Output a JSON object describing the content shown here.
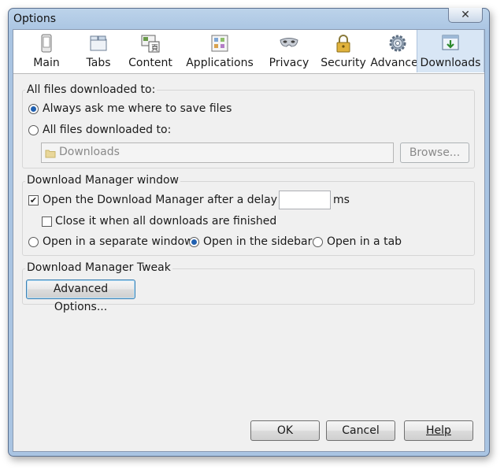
{
  "window": {
    "title": "Options",
    "close_glyph": "✕"
  },
  "tabs": [
    {
      "label": "Main",
      "icon": "main-icon",
      "selected": false
    },
    {
      "label": "Tabs",
      "icon": "tabs-icon",
      "selected": false
    },
    {
      "label": "Content",
      "icon": "content-icon",
      "selected": false
    },
    {
      "label": "Applications",
      "icon": "applications-icon",
      "selected": false
    },
    {
      "label": "Privacy",
      "icon": "privacy-mask-icon",
      "selected": false
    },
    {
      "label": "Security",
      "icon": "lock-icon",
      "selected": false
    },
    {
      "label": "Advanced",
      "icon": "gear-icon",
      "selected": false
    },
    {
      "label": "Downloads",
      "icon": "downloads-icon",
      "selected": true
    }
  ],
  "downloads_group": {
    "label": "All files downloaded to:",
    "always_ask": "Always ask me where to save files",
    "save_to": "All files downloaded to:",
    "folder": "Downloads",
    "browse_label": "Browse..."
  },
  "manager_group": {
    "label": "Download Manager window",
    "open_delay": "Open the Download Manager after a delay of",
    "delay_value": "",
    "delay_unit": "ms",
    "close_when_done": "Close it when all downloads are finished",
    "open_window": "Open in a separate window",
    "open_sidebar": "Open in the sidebar",
    "open_tab": "Open in a tab"
  },
  "tweak_group": {
    "label": "Download Manager Tweak",
    "advanced_options": "Advanced Options..."
  },
  "footer": {
    "ok": "OK",
    "cancel": "Cancel",
    "help": "Help"
  },
  "state": {
    "always_ask_selected": true,
    "open_delay_checked": true,
    "close_when_done_checked": false,
    "open_in": "sidebar"
  },
  "colors": {
    "accent": "#2060b0",
    "selected_tab": "#d8e6f5",
    "frame": "#a9c4e2"
  }
}
